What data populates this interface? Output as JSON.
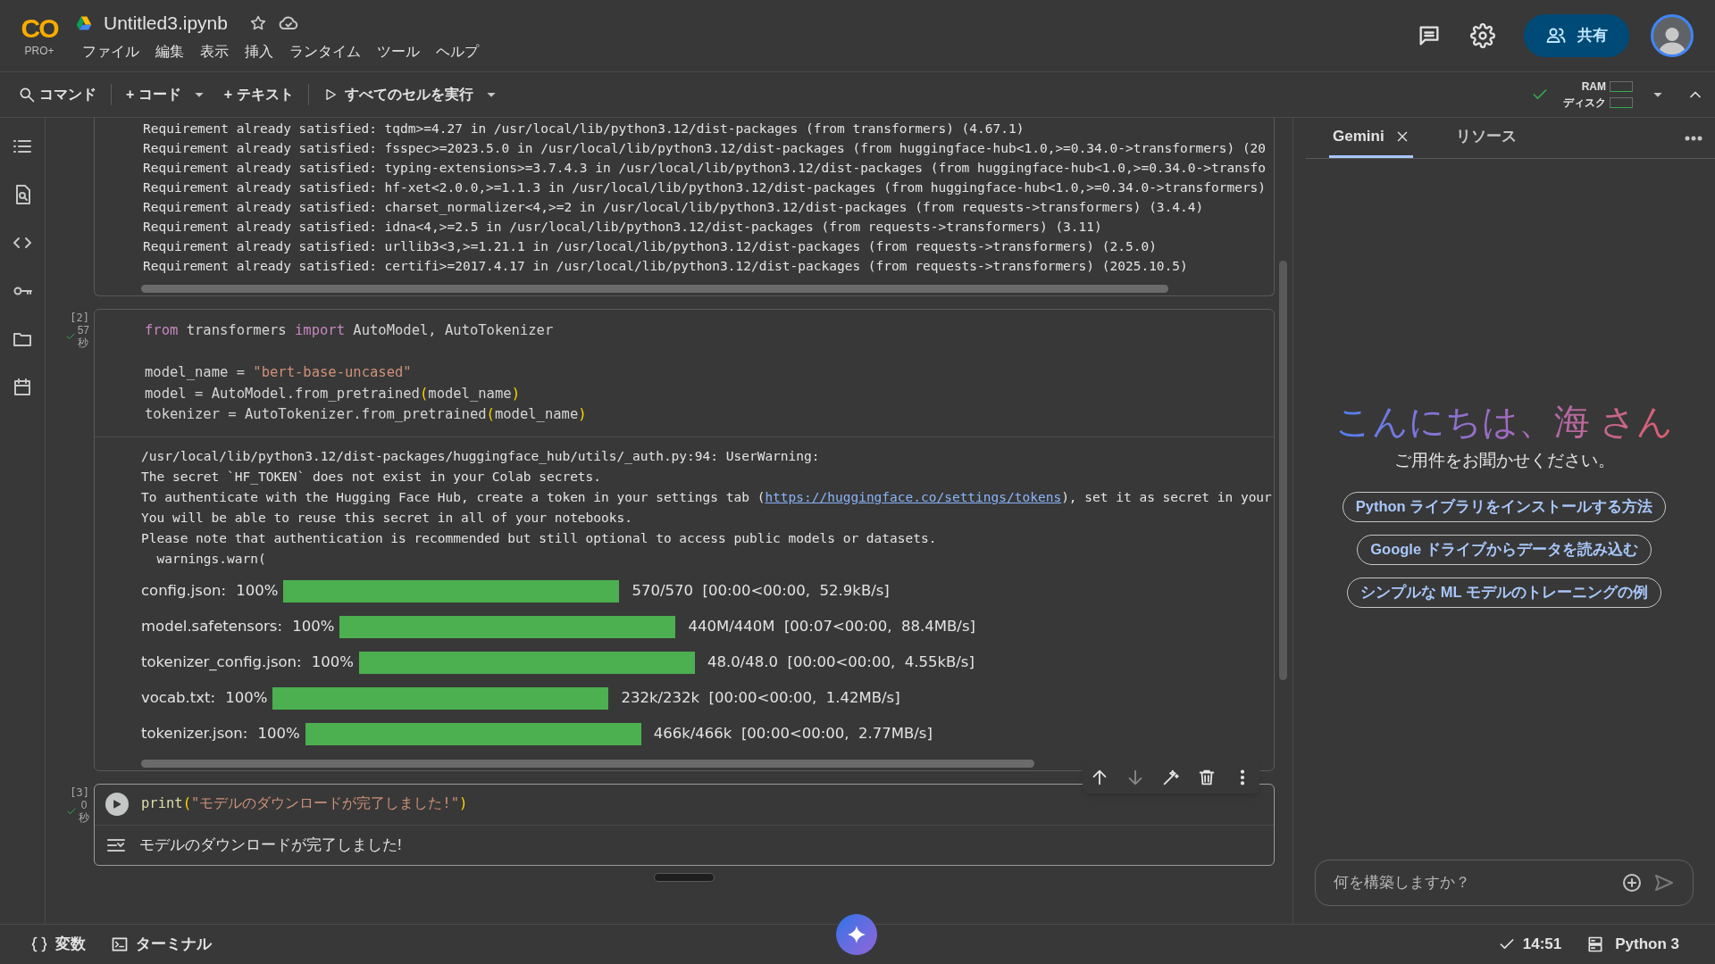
{
  "header": {
    "logo": "CO",
    "plan": "PRO+",
    "title": "Untitled3.ipynb",
    "starred": false,
    "menu": [
      "ファイル",
      "編集",
      "表示",
      "挿入",
      "ランタイム",
      "ツール",
      "ヘルプ"
    ],
    "share": "共有"
  },
  "toolbar": {
    "command": "コマンド",
    "add_code": "+ コード",
    "add_text": "+ テキスト",
    "run_all": "すべてのセルを実行",
    "ram": "RAM",
    "disk": "ディスク",
    "connected": true
  },
  "cells": [
    {
      "kind": "output_only",
      "output_lines": [
        "Requirement already satisfied: tqdm>=4.27 in /usr/local/lib/python3.12/dist-packages (from transformers) (4.67.1)",
        "Requirement already satisfied: fsspec>=2023.5.0 in /usr/local/lib/python3.12/dist-packages (from huggingface-hub<1.0,>=0.34.0->transformers) (20",
        "Requirement already satisfied: typing-extensions>=3.7.4.3 in /usr/local/lib/python3.12/dist-packages (from huggingface-hub<1.0,>=0.34.0->transfo",
        "Requirement already satisfied: hf-xet<2.0.0,>=1.1.3 in /usr/local/lib/python3.12/dist-packages (from huggingface-hub<1.0,>=0.34.0->transformers)",
        "Requirement already satisfied: charset_normalizer<4,>=2 in /usr/local/lib/python3.12/dist-packages (from requests->transformers) (3.4.4)",
        "Requirement already satisfied: idna<4,>=2.5 in /usr/local/lib/python3.12/dist-packages (from requests->transformers) (3.11)",
        "Requirement already satisfied: urllib3<3,>=1.21.1 in /usr/local/lib/python3.12/dist-packages (from requests->transformers) (2.5.0)",
        "Requirement already satisfied: certifi>=2017.4.17 in /usr/local/lib/python3.12/dist-packages (from requests->transformers) (2025.10.5)"
      ]
    },
    {
      "kind": "code",
      "exec_count": "[2]",
      "duration": "57",
      "unit": "秒",
      "success": true,
      "code_blocks": [
        [
          [
            {
              "text": "from",
              "kind": "keyword"
            },
            {
              "text": " transformers ",
              "kind": "plain"
            },
            {
              "text": "import",
              "kind": "keyword"
            },
            {
              "text": " AutoModel, AutoTokenizer",
              "kind": "plain"
            }
          ]
        ],
        [
          [
            {
              "text": "model_name = ",
              "kind": "plain"
            },
            {
              "text": "\"bert-base-uncased\"",
              "kind": "string"
            }
          ],
          [
            {
              "text": "model = AutoModel.from_pretrained",
              "kind": "plain"
            },
            {
              "text": "(",
              "kind": "paren"
            },
            {
              "text": "model_name",
              "kind": "plain"
            },
            {
              "text": ")",
              "kind": "paren"
            }
          ],
          [
            {
              "text": "tokenizer = AutoTokenizer.from_pretrained",
              "kind": "plain"
            },
            {
              "text": "(",
              "kind": "paren"
            },
            {
              "text": "model_name",
              "kind": "plain"
            },
            {
              "text": ")",
              "kind": "paren"
            }
          ]
        ]
      ],
      "warning": [
        "/usr/local/lib/python3.12/dist-packages/huggingface_hub/utils/_auth.py:94: UserWarning:",
        "The secret `HF_TOKEN` does not exist in your Colab secrets."
      ],
      "warning_link_line": {
        "before": "To authenticate with the Hugging Face Hub, create a token in your settings tab (",
        "link": "https://huggingface.co/settings/tokens",
        "after": "), set it as secret in your"
      },
      "warning_tail": [
        "You will be able to reuse this secret in all of your notebooks.",
        "Please note that authentication is recommended but still optional to access public models or datasets.",
        "  warnings.warn("
      ],
      "downloads": [
        {
          "name": "config.json:",
          "percent": "100%",
          "level": 1,
          "stats": "570/570  [00:00<00:00,  52.9kB/s]"
        },
        {
          "name": "model.safetensors:",
          "percent": "100%",
          "level": 1,
          "stats": "440M/440M  [00:07<00:00,  88.4MB/s]"
        },
        {
          "name": "tokenizer_config.json:",
          "percent": "100%",
          "level": 1,
          "stats": "48.0/48.0  [00:00<00:00,  4.55kB/s]"
        },
        {
          "name": "vocab.txt:",
          "percent": "100%",
          "level": 1,
          "stats": "232k/232k  [00:00<00:00,  1.42MB/s]"
        },
        {
          "name": "tokenizer.json:",
          "percent": "100%",
          "level": 1,
          "stats": "466k/466k  [00:00<00:00,  2.77MB/s]"
        }
      ]
    },
    {
      "kind": "code_small",
      "exec_count": "[3]",
      "duration": "0",
      "unit": "秒",
      "success": true,
      "code_line": [
        {
          "text": "print",
          "kind": "builtin"
        },
        {
          "text": "(",
          "kind": "paren"
        },
        {
          "text": "\"モデルのダウンロードが完了しました!\"",
          "kind": "string"
        },
        {
          "text": ")",
          "kind": "paren"
        }
      ],
      "output": "モデルのダウンロードが完了しました!"
    }
  ],
  "panel": {
    "tabs": [
      {
        "label": "Gemini",
        "selected": true,
        "closable": true
      },
      {
        "label": "リソース",
        "selected": false,
        "closable": false
      }
    ],
    "greeting": "こんにちは、海 さん",
    "subtitle": "ご用件をお聞かせください。",
    "suggestions": [
      "Python ライブラリをインストールする方法",
      "Google ドライブからデータを読み込む",
      "シンプルな ML モデルのトレーニングの例"
    ],
    "input": {
      "placeholder": "何を構築しますか？"
    }
  },
  "status_bar": {
    "variables": "変数",
    "terminal": "ターミナル",
    "time": "14:51",
    "runtime": "Python 3"
  }
}
